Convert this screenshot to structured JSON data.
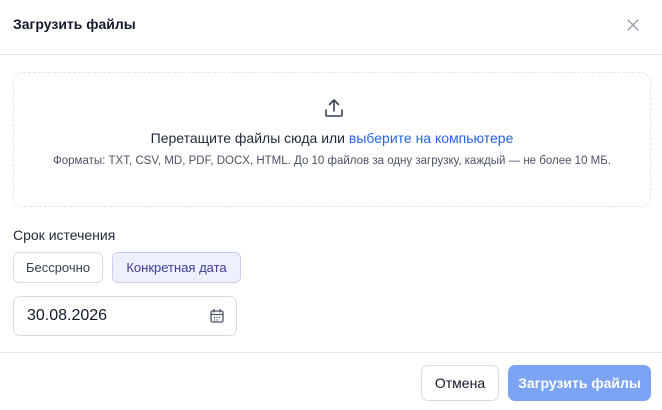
{
  "dialog": {
    "title": "Загрузить файлы",
    "close_icon": "close-icon"
  },
  "dropzone": {
    "icon": "upload-icon",
    "text": "Перетащите файлы сюда или",
    "link": "выберите на компьютере",
    "hint": "Форматы: TXT, CSV, MD, PDF, DOCX, HTML. До 10 файлов за одну загрузку, каждый — не более 10 МБ."
  },
  "expiration": {
    "label": "Срок истечения",
    "options": [
      {
        "label": "Бессрочно",
        "selected": false
      },
      {
        "label": "Конкретная дата",
        "selected": true
      }
    ],
    "date_value": "30.08.2026",
    "date_icon": "calendar-icon"
  },
  "footer": {
    "cancel_label": "Отмена",
    "upload_label": "Загрузить файлы"
  },
  "colors": {
    "accent": "#2563eb",
    "primary_button_disabled": "#7ba4f5",
    "selected_option_bg": "#eef0fd"
  }
}
